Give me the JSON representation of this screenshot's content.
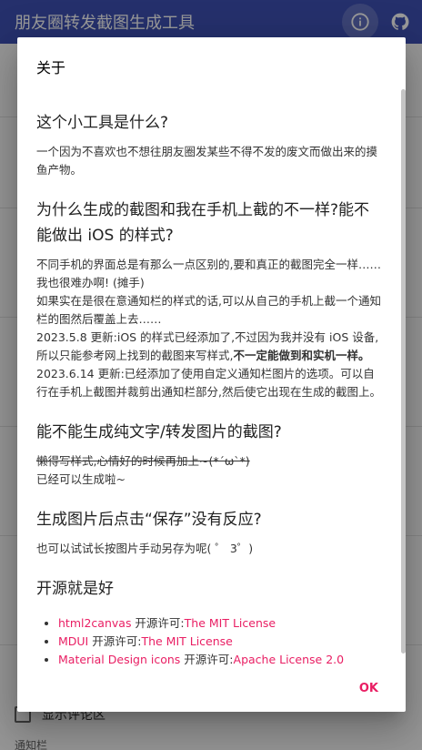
{
  "appbar": {
    "title": "朋友圈转发截图生成工具",
    "icons": [
      "info-icon",
      "github-icon"
    ]
  },
  "background": {
    "checkbox_label": "显示评论区",
    "section_label": "通知栏"
  },
  "dialog": {
    "title": "关于",
    "sections": [
      {
        "heading": "这个小工具是什么?",
        "paragraphs": [
          "一个因为不喜欢也不想往朋友圈发某些不得不发的废文而做出来的摸鱼产物。"
        ]
      },
      {
        "heading": "为什么生成的截图和我在手机上截的不一样?能不能做出 iOS 的样式?",
        "p1": "不同手机的界面总是有那么一点区别的,要和真正的截图完全一样……我也很难办啊! (摊手)",
        "p2": "如果实在是很在意通知栏的样式的话,可以从自己的手机上截一个通知栏的图然后覆盖上去……",
        "p3_a": "2023.5.8 更新:iOS 的样式已经添加了,不过因为我并没有 iOS 设备,所以只能参考网上找到的截图来写样式,",
        "p3_b": "不一定能做到和实机一样。",
        "p4": "2023.6.14 更新:已经添加了使用自定义通知栏图片的选项。可以自行在手机上截图并裁剪出通知栏部分,然后使它出现在生成的截图上。"
      },
      {
        "heading": "能不能生成纯文字/转发图片的截图?",
        "struck": "懒得写样式,心情好的时候再加上~(*´ω`*)",
        "text": "已经可以生成啦~"
      },
      {
        "heading": "生成图片后点击“保存”没有反应?",
        "text": "也可以试试长按图片手动另存为呢( ゜ 3゜)"
      },
      {
        "heading": "开源就是好",
        "links": [
          {
            "name": "html2canvas",
            "mid": " 开源许可:",
            "license": "The MIT License"
          },
          {
            "name": "MDUI",
            "mid": " 开源许可:",
            "license": "The MIT License"
          },
          {
            "name": "Material Design icons",
            "mid": " 开源许可:",
            "license": "Apache License 2.0"
          }
        ]
      }
    ],
    "ok_label": "OK"
  },
  "colors": {
    "primary": "#3f51b5",
    "accent": "#e91e63"
  }
}
